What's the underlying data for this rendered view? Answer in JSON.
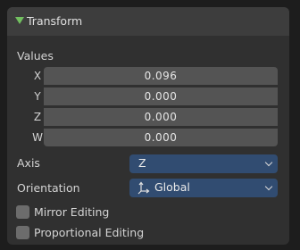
{
  "panel": {
    "title": "Transform",
    "expanded": true,
    "arrow_color": "#72c060"
  },
  "values": {
    "label": "Values",
    "components": [
      {
        "label": "X",
        "value": "0.096"
      },
      {
        "label": "Y",
        "value": "0.000"
      },
      {
        "label": "Z",
        "value": "0.000"
      },
      {
        "label": "W",
        "value": "0.000"
      }
    ]
  },
  "axis": {
    "label": "Axis",
    "selected": "Z"
  },
  "orientation": {
    "label": "Orientation",
    "selected": "Global",
    "icon": "orientation-global-icon"
  },
  "options": {
    "mirror_editing": {
      "label": "Mirror Editing",
      "checked": false
    },
    "proportional_editing": {
      "label": "Proportional Editing",
      "checked": false
    }
  },
  "colors": {
    "dropdown_bg": "#314c71",
    "field_bg": "#545454",
    "panel_bg": "#303030",
    "header_bg": "#3d3d3d"
  }
}
